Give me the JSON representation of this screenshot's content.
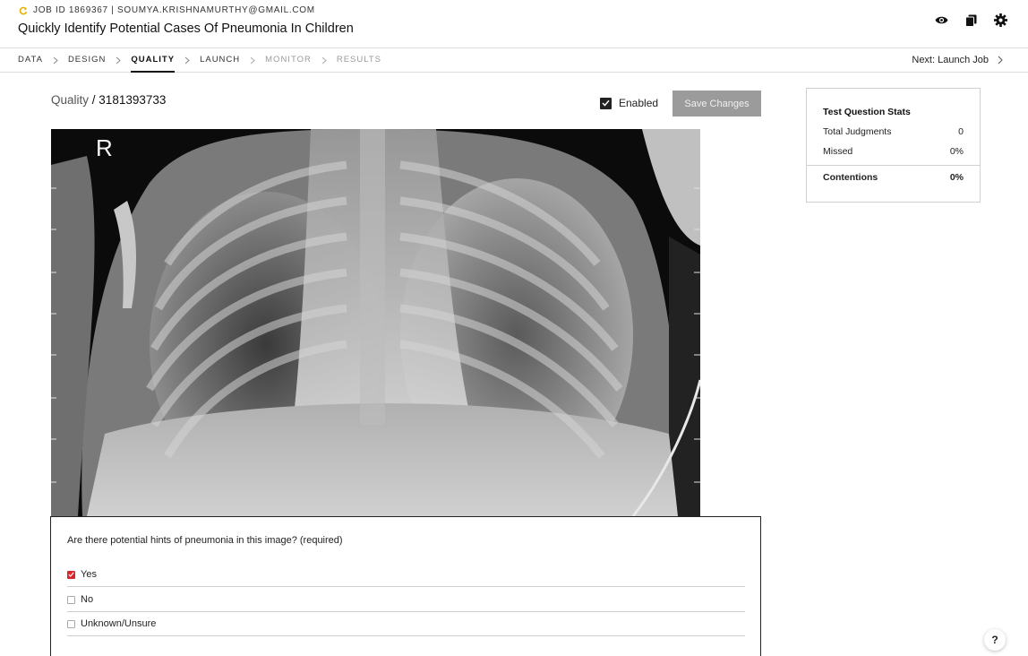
{
  "header": {
    "job_meta": "JOB ID 1869367 | SOUMYA.KRISHNAMURTHY@GMAIL.COM",
    "title": "Quickly Identify Potential Cases Of Pneumonia In Children",
    "icons": [
      "eye-icon",
      "copy-icon",
      "gear-icon"
    ]
  },
  "nav": {
    "steps": [
      {
        "label": "DATA",
        "state": "done"
      },
      {
        "label": "DESIGN",
        "state": "done"
      },
      {
        "label": "QUALITY",
        "state": "active"
      },
      {
        "label": "LAUNCH",
        "state": "done"
      },
      {
        "label": "MONITOR",
        "state": "disabled"
      },
      {
        "label": "RESULTS",
        "state": "disabled"
      }
    ],
    "next_label": "Next: Launch Job"
  },
  "breadcrumb": {
    "parent": "Quality",
    "separator": " / ",
    "current": "3181393733"
  },
  "toolbar": {
    "enabled_label": "Enabled",
    "enabled_checked": true,
    "save_label": "Save Changes"
  },
  "image": {
    "marker_text": "R"
  },
  "question": {
    "text": "Are there potential hints of pneumonia in this image? (required)",
    "options": [
      {
        "label": "Yes",
        "checked": true
      },
      {
        "label": "No",
        "checked": false
      },
      {
        "label": "Unknown/Unsure",
        "checked": false
      }
    ]
  },
  "stats": {
    "title": "Test Question Stats",
    "total_judgments_label": "Total Judgments",
    "total_judgments_value": "0",
    "missed_label": "Missed",
    "missed_value": "0%",
    "contentions_label": "Contentions",
    "contentions_value": "0%"
  },
  "help": {
    "label": "?"
  },
  "colors": {
    "accent_yellow": "#e9b400",
    "checked_red": "#d9262c",
    "save_button_bg": "#9b9b9b"
  }
}
